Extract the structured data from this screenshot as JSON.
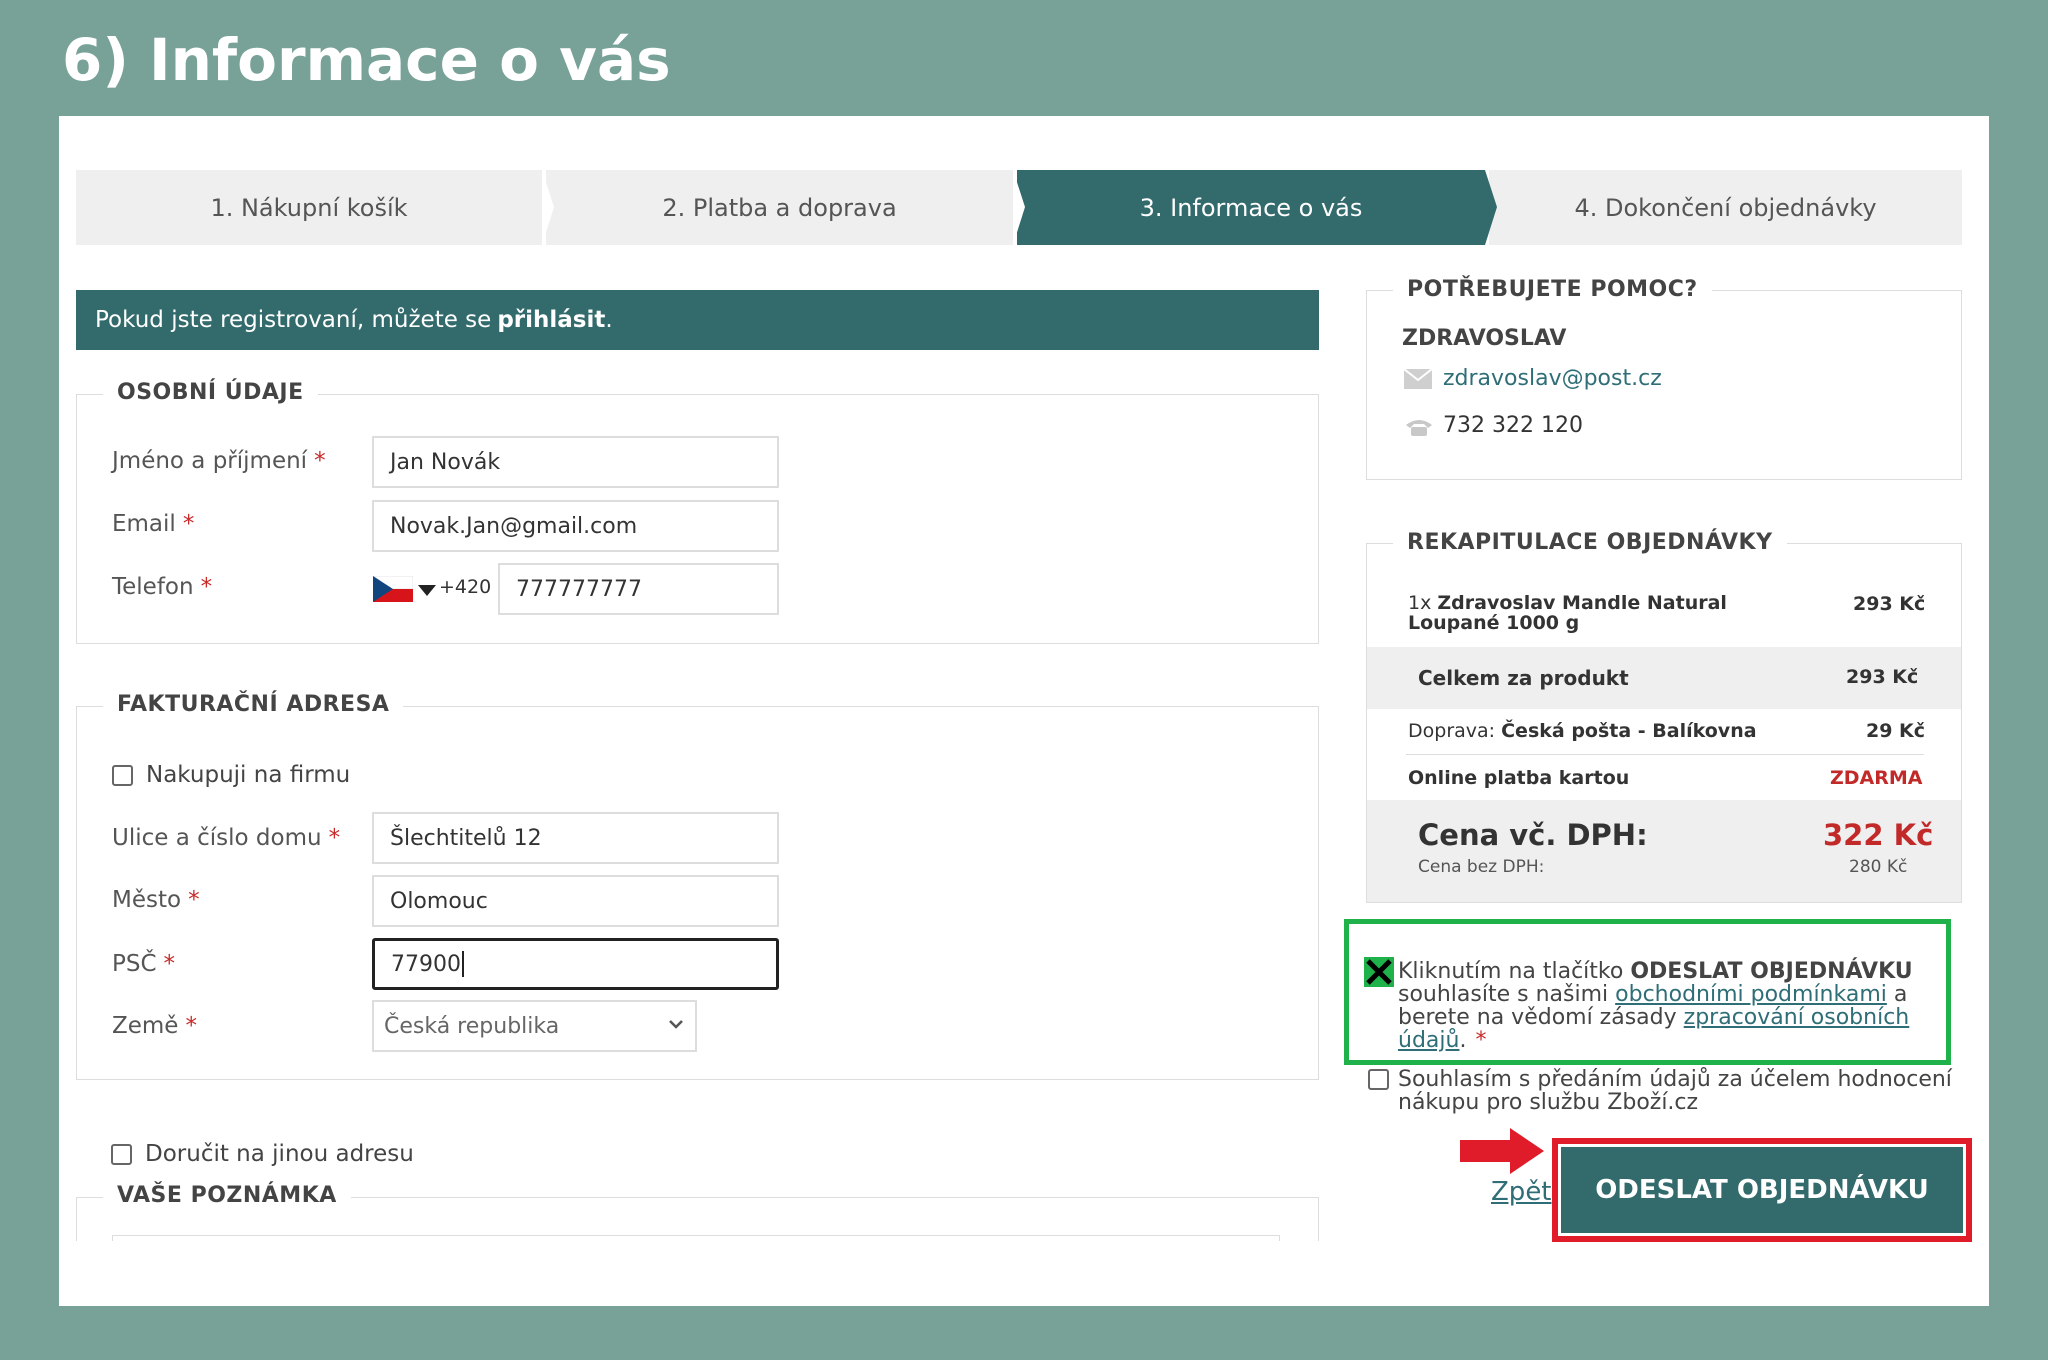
{
  "heading": "6) Informace o vás",
  "steps": [
    {
      "label": "1. Nákupní košík"
    },
    {
      "label": "2. Platba a doprava"
    },
    {
      "label": "3. Informace o vás"
    },
    {
      "label": "4. Dokončení objednávky"
    }
  ],
  "login_banner": {
    "text": "Pokud jste registrovaní, můžete se",
    "link": "přihlásit",
    "suffix": "."
  },
  "personal": {
    "legend": "OSOBNÍ ÚDAJE",
    "name_label": "Jméno a příjmení",
    "name_value": "Jan Novák",
    "email_label": "Email",
    "email_value": "Novak.Jan@gmail.com",
    "phone_label": "Telefon",
    "phone_prefix": "+420",
    "phone_value": "777777777",
    "required": "*"
  },
  "billing": {
    "legend": "FAKTURAČNÍ ADRESA",
    "company_checkbox_label": "Nakupuji na firmu",
    "street_label": "Ulice a číslo domu",
    "street_value": "Šlechtitelů 12",
    "city_label": "Město",
    "city_value": "Olomouc",
    "zip_label": "PSČ",
    "zip_value": "77900",
    "country_label": "Země",
    "country_value": "Česká republika"
  },
  "other_address_label": "Doručit na jinou adresu",
  "note_legend": "VAŠE POZNÁMKA",
  "help": {
    "legend": "POTŘEBUJETE POMOC?",
    "company": "ZDRAVOSLAV",
    "email": "zdravoslav@post.cz",
    "phone": "732 322 120"
  },
  "recap": {
    "legend": "REKAPITULACE OBJEDNÁVKY",
    "item_qty": "1x",
    "item_name_line1": "Zdravoslav Mandle Natural",
    "item_name_line2": "Loupané 1000 g",
    "item_price": "293 Kč",
    "product_total_label": "Celkem za produkt",
    "product_total_value": "293 Kč",
    "shipping_prefix": "Doprava:",
    "shipping_name": "Česká pošta - Balíkovna",
    "shipping_price": "29 Kč",
    "payment_label": "Online platba kartou",
    "payment_value": "ZDARMA",
    "total_label": "Cena vč. DPH:",
    "total_value": "322 Kč",
    "net_label": "Cena bez DPH:",
    "net_value": "280 Kč"
  },
  "agreement": {
    "line1_prefix": "Kliknutím na tlačítko",
    "line1_bold": "ODESLAT OBJEDNÁVKU",
    "line2_prefix": "souhlasíte s našimi",
    "terms_link": "obchodními podmínkami",
    "line2_suffix": "a",
    "line3_prefix": "berete na vědomí zásady",
    "privacy_link_part1": "zpracování osobních",
    "privacy_link_part2": "údajů",
    "line4_suffix": ".",
    "required": "*"
  },
  "zbozi_consent_line1": "Souhlasím s předáním údajů za účelem hodnocení",
  "zbozi_consent_line2": "nákupu pro službu Zboží.cz",
  "back_link": "Zpět",
  "submit_label": "ODESLAT OBJEDNÁVKU",
  "colors": {
    "accent": "#336b6d",
    "background": "#78a197",
    "highlight_green": "#1fb24a",
    "highlight_red": "#e01b2a"
  }
}
